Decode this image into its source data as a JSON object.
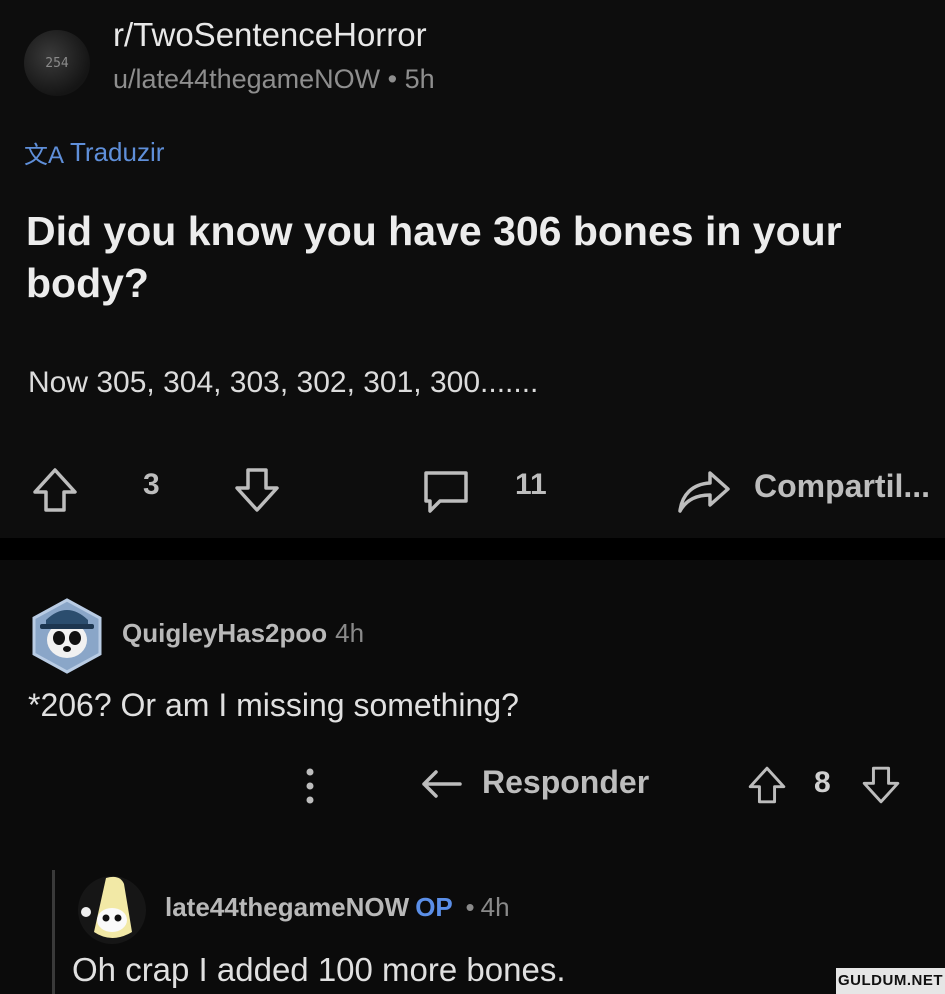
{
  "post": {
    "subreddit": "r/TwoSentenceHorror",
    "avatar_text": "254",
    "author": "u/late44thegameNOW",
    "separator": "•",
    "age": "5h",
    "translate_label": "Traduzir",
    "translate_icon": "文A",
    "title": "Did you know you have 306 bones in your body?",
    "body": "Now 305, 304, 303, 302, 301, 300.......",
    "upvotes": "3",
    "comments": "11",
    "share_label": "Compartil..."
  },
  "comment": {
    "author": "QuigleyHas2poo",
    "age": "4h",
    "body": "*206? Or am I missing something?",
    "reply_label": "Responder",
    "score": "8"
  },
  "reply": {
    "author": "late44thegameNOW",
    "op_badge": "OP",
    "separator": "•",
    "age": "4h",
    "body": "Oh crap I added 100 more bones."
  },
  "watermark": "GULDUM.NET",
  "colors": {
    "background": "#0b0b0b",
    "link_blue": "#5f8fd9",
    "op_blue": "#5b8fe8",
    "muted_text": "#8e8e8e"
  }
}
